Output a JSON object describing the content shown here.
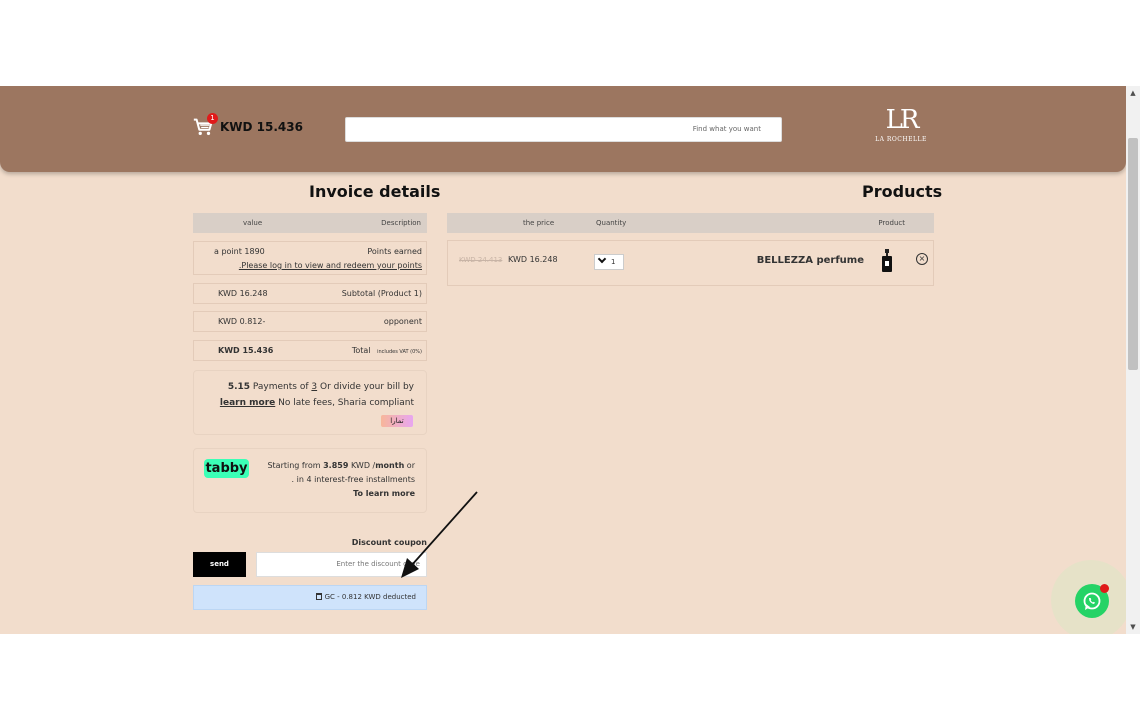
{
  "header": {
    "cart_count": "1",
    "cart_total": "KWD 15.436",
    "search_placeholder": "Find what you want",
    "logo_mark": "LR",
    "logo_text": "LA ROCHELLE"
  },
  "invoice": {
    "title": "Invoice details",
    "col_value": "value",
    "col_description": "Description",
    "points_value": "a point 1890",
    "points_label": "Points earned",
    "login_link": ".Please log in to view and redeem your points",
    "subtotal_value": "KWD 16.248",
    "subtotal_label": "Subtotal (Product 1)",
    "opponent_value": "KWD 0.812-",
    "opponent_label": "opponent",
    "total_value": "KWD 15.436",
    "total_label": "Total",
    "vat_note": "includes VAT (0%)"
  },
  "tamara": {
    "amount": "5.15",
    "line1_text": " Payments of ",
    "count": "3",
    "line1_tail": " Or divide your bill by",
    "learn_more": "learn more",
    "line2_tail": " No late fees, Sharia compliant",
    "badge": "تمارا"
  },
  "tabby": {
    "logo": "tabby",
    "prefix": "Starting from ",
    "amount": "3.859",
    "mid": " KWD /",
    "unit": "month",
    "suffix": " or",
    "line2": ". in 4 interest-free installments",
    "link": "To learn more"
  },
  "coupon": {
    "label": "Discount coupon",
    "send": "send",
    "placeholder": "Enter the discount code",
    "applied": "GC - 0.812 KWD deducted"
  },
  "products": {
    "title": "Products",
    "col_price": "the price",
    "col_quantity": "Quantity",
    "col_product": "Product",
    "item": {
      "old_price": "KWD 24.413",
      "price": "KWD 16.248",
      "quantity": "1",
      "name": "BELLEZZA perfume"
    }
  },
  "colors": {
    "page_bg": "#f2ddcc",
    "header_bg": "#9c7660",
    "tabby_green": "#3bffb6",
    "coupon_applied_bg": "#cfe3fb",
    "whatsapp_green": "#25d366"
  },
  "icons": [
    "cart-icon",
    "trash-icon",
    "remove-icon",
    "whatsapp-icon",
    "scroll-up-icon",
    "scroll-down-icon"
  ]
}
